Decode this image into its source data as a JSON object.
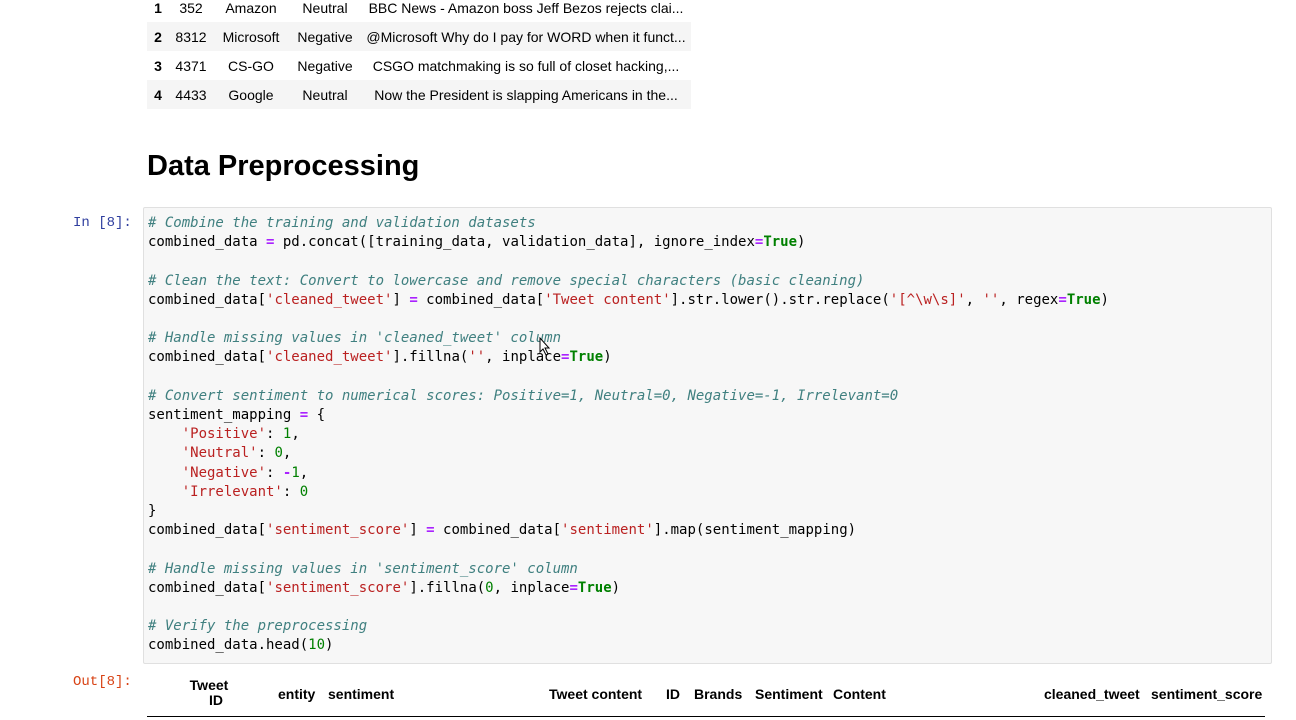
{
  "top_table": {
    "rows": [
      {
        "index": "1",
        "id": "352",
        "entity": "Amazon",
        "sentiment": "Neutral",
        "content": "BBC News - Amazon boss Jeff Bezos rejects clai..."
      },
      {
        "index": "2",
        "id": "8312",
        "entity": "Microsoft",
        "sentiment": "Negative",
        "content": "@Microsoft Why do I pay for WORD when it funct..."
      },
      {
        "index": "3",
        "id": "4371",
        "entity": "CS-GO",
        "sentiment": "Negative",
        "content": "CSGO matchmaking is so full of closet hacking,..."
      },
      {
        "index": "4",
        "id": "4433",
        "entity": "Google",
        "sentiment": "Neutral",
        "content": "Now the President is slapping Americans in the..."
      }
    ]
  },
  "section_heading": "Data Preprocessing",
  "input_prompt": "In [8]:",
  "output_prompt": "Out[8]:",
  "code_lines": [
    "# Combine the training and validation datasets",
    "combined_data = pd.concat([training_data, validation_data], ignore_index=True)",
    "",
    "# Clean the text: Convert to lowercase and remove special characters (basic cleaning)",
    "combined_data['cleaned_tweet'] = combined_data['Tweet content'].str.lower().str.replace('[^\\w\\s]', '', regex=True)",
    "",
    "# Handle missing values in 'cleaned_tweet' column",
    "combined_data['cleaned_tweet'].fillna('', inplace=True)",
    "",
    "# Convert sentiment to numerical scores: Positive=1, Neutral=0, Negative=-1, Irrelevant=0",
    "sentiment_mapping = {",
    "    'Positive': 1,",
    "    'Neutral': 0,",
    "    'Negative': -1,",
    "    'Irrelevant': 0",
    "}",
    "combined_data['sentiment_score'] = combined_data['sentiment'].map(sentiment_mapping)",
    "",
    "# Handle missing values in 'sentiment_score' column",
    "combined_data['sentiment_score'].fillna(0, inplace=True)",
    "",
    "# Verify the preprocessing",
    "combined_data.head(10)"
  ],
  "output_columns": {
    "tweet_id_line1": "Tweet",
    "tweet_id_line2": "ID",
    "entity": "entity",
    "sentiment": "sentiment",
    "tweet_content": "Tweet content",
    "id": "ID",
    "brands": "Brands",
    "sentiment_cap": "Sentiment",
    "content": "Content",
    "cleaned_tweet": "cleaned_tweet",
    "sentiment_score": "sentiment_score"
  },
  "colors": {
    "in_prompt": "#303f9f",
    "out_prompt": "#d84315",
    "comment": "#408080",
    "string": "#ba2121",
    "keyword": "#008000"
  },
  "icons": {
    "cursor": "i-beam-cursor-icon"
  }
}
